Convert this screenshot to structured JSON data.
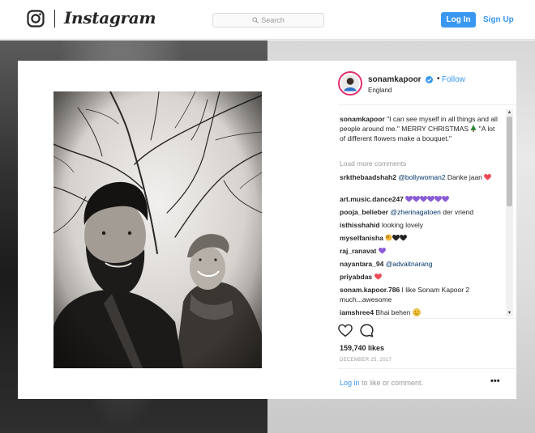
{
  "header": {
    "brand": "Instagram",
    "search_placeholder": "Search",
    "login_label": "Log In",
    "signup_label": "Sign Up"
  },
  "post": {
    "username": "sonamkapoor",
    "dot": "•",
    "follow_label": "Follow",
    "location": "England",
    "caption_user": "sonamkapoor",
    "caption_text_1": " \"I can see myself in all things and all people around me.\" MERRY CHRISTMAS ",
    "caption_text_2": " \"A lot of different flowers make a bouquet.\"",
    "load_more": "Load more comments",
    "comments": [
      {
        "user": "srkthebaadshah2",
        "mention": "@bollywoman2",
        "text": " Danke jaan"
      },
      {
        "user": "art.music.dance247",
        "mention": "",
        "text": ""
      },
      {
        "user": "pooja_belieber",
        "mention": "@zherinagatoen",
        "text": " der vriend"
      },
      {
        "user": "isthisshahid",
        "mention": "",
        "text": " looking lovely"
      },
      {
        "user": "myselfanisha",
        "mention": "",
        "text": ""
      },
      {
        "user": "raj_ranavat",
        "mention": "",
        "text": ""
      },
      {
        "user": "nayantara_94",
        "mention": "@advaitnarang",
        "text": ""
      },
      {
        "user": "priyabdas",
        "mention": "",
        "text": ""
      },
      {
        "user": "sonam.kapoor.786",
        "mention": "",
        "text": " I like Sonam Kapoor 2 much...awesome"
      },
      {
        "user": "iamshree4",
        "mention": "",
        "text": " Bhai behen "
      }
    ],
    "likes": "159,740 likes",
    "date": "DECEMBER 25, 2017",
    "footer_login": "Log in",
    "footer_text": " to like or comment.",
    "more_options": "•••"
  },
  "colors": {
    "accent": "#3897f0",
    "heart_red": "#ed4956",
    "purple_heart": "#8a5cd6",
    "verified_blue": "#3897f0"
  }
}
